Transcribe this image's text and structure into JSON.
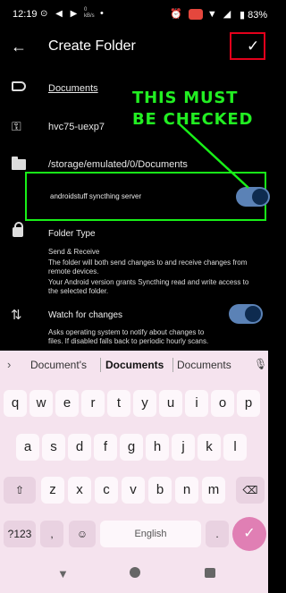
{
  "status_bar": {
    "time": "12:19",
    "left_icons": "⊙ ◀ ▶",
    "net_speed": "0\nkB/s",
    "dot": "•",
    "right_icons": "⏰ ⬤ ▼ ◢",
    "battery": "83%"
  },
  "app_bar": {
    "back": "←",
    "title": "Create Folder",
    "confirm": "✓"
  },
  "fields": {
    "label": "Documents",
    "id": "hvc75-uexp7",
    "path": "/storage/emulated/0/Documents",
    "device": "androidstuff syncthing server",
    "device_shared": true
  },
  "annotation": {
    "text": "THIS MUST\nBE CHECKED",
    "color": "#22ee22"
  },
  "folder_type": {
    "title": "Folder Type",
    "value": "Send & Receive",
    "desc_line1": "The folder will both send changes to and receive changes from",
    "desc_line2": "remote devices.",
    "android_line1": "Your Android version grants Syncthing read and write access to",
    "android_line2": "the selected folder."
  },
  "watch": {
    "title": "Watch for changes",
    "enabled": true,
    "desc_line1": "Asks operating system to notify about changes to",
    "desc_line2": "files. If disabled falls back to periodic hourly scans."
  },
  "keyboard": {
    "suggestions": [
      "Document's",
      "Documents",
      "Documents"
    ],
    "row1": [
      "q",
      "w",
      "e",
      "r",
      "t",
      "y",
      "u",
      "i",
      "o",
      "p"
    ],
    "row2": [
      "a",
      "s",
      "d",
      "f",
      "g",
      "h",
      "j",
      "k",
      "l"
    ],
    "row3": [
      "z",
      "x",
      "c",
      "v",
      "b",
      "n",
      "m"
    ],
    "symbols": "?123",
    "comma": ",",
    "space_label": "English",
    "period": "."
  },
  "icons": {
    "back": "arrow-left-icon",
    "confirm": "check-icon",
    "label": "label-icon",
    "id": "key-icon",
    "path": "folder-icon",
    "type": "lock-icon",
    "watch": "sync-icon"
  },
  "colors": {
    "accent_toggle": "#5b82b6",
    "highlight_red": "#e3001b",
    "highlight_green": "#18f018",
    "keyboard_bg": "#f5e3ee",
    "enter_key": "#e07fb4"
  }
}
